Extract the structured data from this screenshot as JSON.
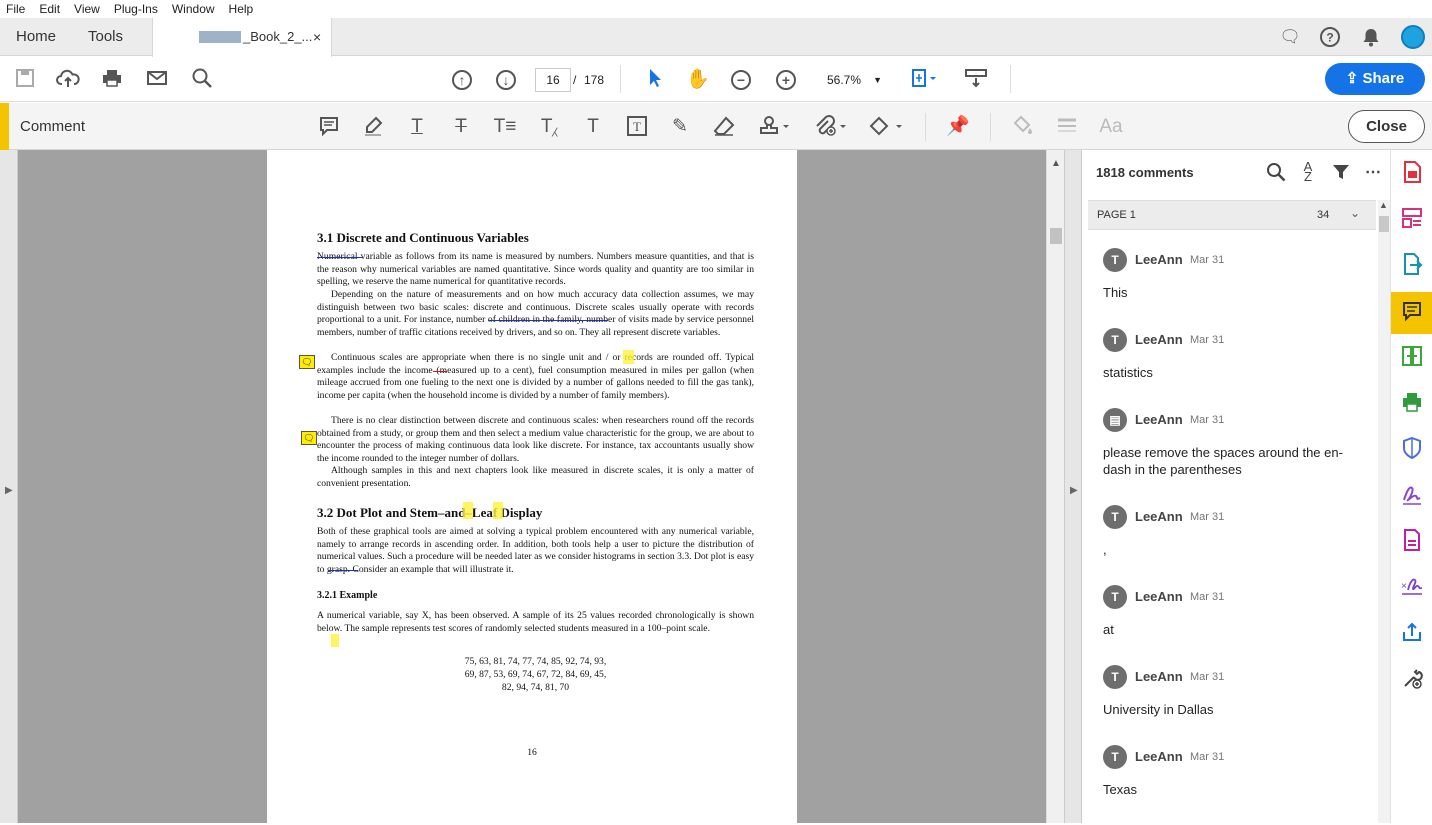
{
  "menu": [
    "File",
    "Edit",
    "View",
    "Plug-Ins",
    "Window",
    "Help"
  ],
  "tabs": {
    "home": "Home",
    "tools": "Tools",
    "doc": "_Book_2_...",
    "close": "×"
  },
  "nav": {
    "page_current": "16",
    "page_sep": "/",
    "page_total": "178",
    "zoom": "56.7%"
  },
  "share_label": "Share",
  "comment_bar": {
    "title": "Comment",
    "close_label": "Close"
  },
  "page": {
    "h31": "3.1   Discrete and Continuous Variables",
    "p1": "Numerical variable as follows from its name is measured by numbers. Numbers measure quantities, and that is the reason why numerical variables are named quantitative. Since words quality and quantity are too similar in spelling, we reserve the name numerical for quantitative records.",
    "p2": "Depending on the nature of measurements and on how much accuracy data collection assumes, we may distinguish between two basic scales: discrete and continuous. Discrete scales usually operate with records proportional to a unit. For instance, number of children in the family, number of visits made by service personnel members, number of traffic citations received by drivers, and so on. They all represent discrete variables.",
    "p3": "Continuous scales are appropriate when there is no single unit and / or records are rounded off. Typical examples include the income (measured up to a cent), fuel consumption measured in miles per gallon (when mileage accrued from one fueling to the next one is divided by a number of gallons needed to fill the gas tank), income per capita (when the household income is divided by a number of family members).",
    "p4": "There is no clear distinction between discrete and continuous scales: when researchers round off the records obtained from a study, or group them and then select a medium value characteristic for the group, we are about to encounter the process of making continuous data look like discrete. For instance, tax accountants usually show the income rounded to the integer number of dollars.",
    "p5": "Although samples in this and next chapters look like measured in discrete scales, it is only a matter of convenient presentation.",
    "h32": "3.2   Dot Plot and Stem–and–Leaf Display",
    "p6": "Both of these graphical tools are aimed at solving a typical problem encountered with any numerical variable, namely to arrange records in ascending order. In addition, both tools help a user to picture the distribution of numerical values. Such a procedure will be needed later as we consider histograms in section 3.3. Dot plot is easy to grasp. Consider an example that will illustrate it.",
    "h321": "3.2.1   Example",
    "p7": "A numerical variable, say X, has been observed. A sample of its 25 values recorded chronologically is shown below. The sample represents test scores of randomly selected students measured in a 100–point scale.",
    "data1": "75, 63, 81, 74, 77, 74, 85, 92, 74, 93,",
    "data2": "69, 87, 53, 69, 74, 67, 72, 84, 69, 45,",
    "data3": "82, 94, 74, 81, 70",
    "page_number": "16"
  },
  "pane": {
    "count": "1818 comments",
    "group_label": "PAGE 1",
    "group_count": "34",
    "comments": [
      {
        "author": "LeeAnn",
        "date": "Mar 31",
        "text": "This",
        "icon": "T"
      },
      {
        "author": "LeeAnn",
        "date": "Mar 31",
        "text": "statistics",
        "icon": "T"
      },
      {
        "author": "LeeAnn",
        "date": "Mar 31",
        "text": "please remove the spaces around the en-dash in the parentheses",
        "icon": "▤"
      },
      {
        "author": "LeeAnn",
        "date": "Mar 31",
        "text": ",",
        "icon": "T"
      },
      {
        "author": "LeeAnn",
        "date": "Mar 31",
        "text": "at",
        "icon": "T"
      },
      {
        "author": "LeeAnn",
        "date": "Mar 31",
        "text": "University in Dallas",
        "icon": "T"
      },
      {
        "author": "LeeAnn",
        "date": "Mar 31",
        "text": "Texas",
        "icon": "T"
      }
    ]
  },
  "colors": {
    "accent": "#f5c400",
    "share": "#1473e6",
    "highlight": "#fff23a",
    "avatar": "#1fa3e0"
  }
}
